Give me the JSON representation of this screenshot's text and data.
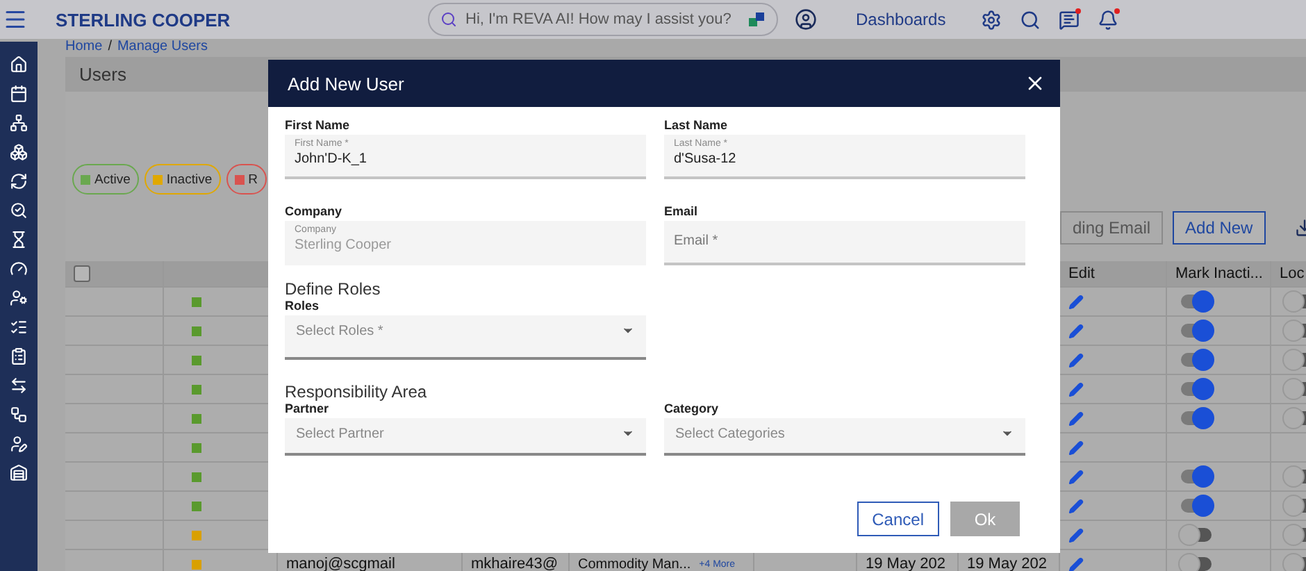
{
  "header": {
    "brand": "STERLING COOPER",
    "search": {
      "placeholder": "Hi, I'm REVA AI! How may I assist you?"
    },
    "nav_link": "Dashboards",
    "notifications": {
      "chat_unread": true,
      "bell_unread": true
    }
  },
  "breadcrumb": {
    "items": [
      "Home",
      "Manage Users"
    ],
    "separator": "/"
  },
  "card": {
    "title": "Users"
  },
  "legend": [
    {
      "label": "Active",
      "color": "#6aa84f"
    },
    {
      "label": "Inactive",
      "color": "#e0a800"
    },
    {
      "label": "R",
      "color": "#d9534f"
    }
  ],
  "toolbar": {
    "buttons": [
      "ding Email",
      "Add New"
    ]
  },
  "table": {
    "select_all": {
      "checked": false
    },
    "columns": [
      "Edit",
      "Mark Inacti...",
      "Loc"
    ],
    "rows": [
      {
        "color": "#5a9a2e",
        "mark_inactive": {
          "on": true
        },
        "lock": {
          "on": false
        }
      },
      {
        "color": "#5a9a2e",
        "mark_inactive": {
          "on": true
        },
        "lock": {
          "on": false
        }
      },
      {
        "color": "#5a9a2e",
        "mark_inactive": {
          "on": true
        },
        "lock": {
          "on": false
        }
      },
      {
        "color": "#5a9a2e",
        "mark_inactive": {
          "on": true
        },
        "lock": {
          "on": false
        }
      },
      {
        "color": "#5a9a2e",
        "mark_inactive": {
          "on": true
        },
        "lock": {
          "on": false
        }
      },
      {
        "color": "#5a9a2e"
      },
      {
        "color": "#5a9a2e",
        "mark_inactive": {
          "on": true
        },
        "lock": {
          "on": false
        }
      },
      {
        "color": "#5a9a2e",
        "mark_inactive": {
          "on": true
        },
        "lock": {
          "on": false
        }
      },
      {
        "color": "#d9a000",
        "mark_inactive": {
          "on": false
        },
        "lock": {
          "on": false
        }
      },
      {
        "color": "#d9a000",
        "email": "manoj@scgmail",
        "username": "mkhaire43@",
        "role": "Commodity Man...",
        "more": "+4 More",
        "created": "19 May 202",
        "updated": "19 May 202",
        "mark_inactive": {
          "on": false
        },
        "lock": {
          "on": false
        }
      }
    ]
  },
  "dialog": {
    "title": "Add New User",
    "fields": [
      {
        "label": "First Name",
        "floating_label": "First Name *",
        "value": "John'D-K_1"
      },
      {
        "label": "Last Name",
        "floating_label": "Last Name *",
        "value": "d'Susa-12"
      },
      {
        "label": "Company",
        "floating_label": "Company",
        "value": "Sterling Cooper",
        "disabled": true
      },
      {
        "label": "Email",
        "placeholder": "Email *"
      }
    ],
    "roles_section": {
      "heading": "Define Roles",
      "label": "Roles",
      "placeholder": "Select Roles *"
    },
    "responsibility_section": {
      "heading": "Responsibility Area",
      "selects": [
        {
          "label": "Partner",
          "placeholder": "Select Partner"
        },
        {
          "label": "Category",
          "placeholder": "Select Categories"
        }
      ]
    },
    "buttons": [
      {
        "label": "Cancel",
        "disabled": false
      },
      {
        "label": "Ok",
        "disabled": true
      }
    ]
  }
}
